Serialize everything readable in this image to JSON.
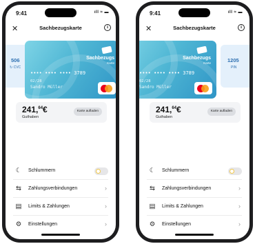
{
  "status": {
    "time": "9:41",
    "icons": "ıll ≈ ▬"
  },
  "nav": {
    "title": "Sachbezugskarte",
    "close_icon": "close-icon",
    "info_icon": "info-icon",
    "info_glyph": "i",
    "close_glyph": "✕"
  },
  "card": {
    "brand": "Sachbezugs",
    "brand_sub": "Karte",
    "pan_masked": "•••• •••• ••••",
    "last4": "3789",
    "expiry": "02/28",
    "holder": "Sandro Müller"
  },
  "cvc": {
    "value": "506",
    "label": "CVC"
  },
  "pin": {
    "value": "1205",
    "label": "PIN"
  },
  "balance": {
    "amount_main": "241,",
    "amount_cents": "64",
    "currency": "€",
    "caption": "Guthaben",
    "topup_label": "Karte aufladen"
  },
  "menu": {
    "items": [
      {
        "label": "Schlummern",
        "icon": "sleep-icon",
        "glyph": "☾"
      },
      {
        "label": "Zahlungsverbindungen",
        "icon": "payment-connections-icon",
        "glyph": "⇆"
      },
      {
        "label": "Limits & Zahlungen",
        "icon": "limits-icon",
        "glyph": "▤"
      },
      {
        "label": "Einstellungen",
        "icon": "settings-icon",
        "glyph": "⚙"
      }
    ],
    "chevron": "›"
  },
  "colors": {
    "accent": "#2d6fb1",
    "card_gradient_start": "#7ed4e6",
    "card_gradient_end": "#2f95c6",
    "toggle_knob_ring": "#f3c94b"
  }
}
